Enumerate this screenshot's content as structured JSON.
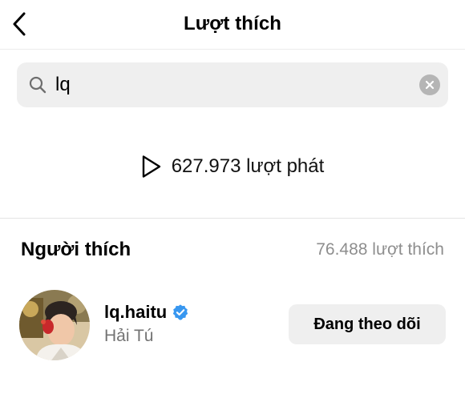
{
  "header": {
    "title": "Lượt thích",
    "back_icon": "chevron-left-icon"
  },
  "search": {
    "value": "lq",
    "search_icon": "search-icon",
    "clear_icon": "clear-icon"
  },
  "plays": {
    "icon": "play-icon",
    "text": "627.973 lượt phát"
  },
  "likers_section": {
    "title": "Người thích",
    "count_text": "76.488 lượt thích"
  },
  "users": [
    {
      "username": "lq.haitu",
      "display_name": "Hải Tú",
      "verified": true,
      "follow_label": "Đang theo dõi"
    }
  ],
  "colors": {
    "verified": "#3897f0",
    "secondary_text": "#737373",
    "count_text": "#8e8e8e",
    "button_bg": "#efefef"
  }
}
